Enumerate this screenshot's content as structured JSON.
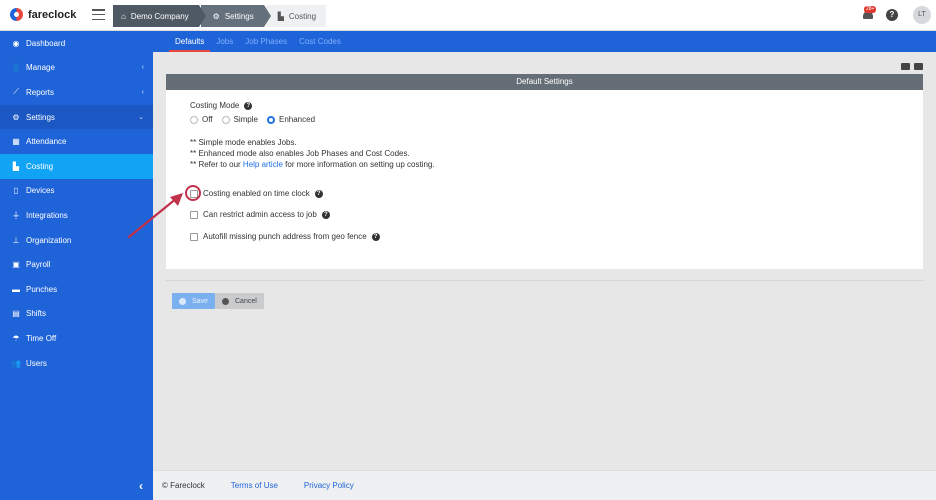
{
  "app": {
    "name": "fareclock"
  },
  "breadcrumbs": [
    {
      "label": "Demo Company",
      "icon": "home-icon"
    },
    {
      "label": "Settings",
      "icon": "gear-icon"
    },
    {
      "label": "Costing",
      "icon": "factory-icon"
    }
  ],
  "header": {
    "notification_count": "28+",
    "help": "?",
    "avatar_initials": "LT"
  },
  "sidebar": {
    "items": [
      {
        "label": "Dashboard",
        "icon": "dashboard-icon"
      },
      {
        "label": "Manage",
        "icon": "user-icon",
        "chevron": "‹"
      },
      {
        "label": "Reports",
        "icon": "chart-icon",
        "chevron": "‹"
      },
      {
        "label": "Settings",
        "icon": "gear-icon",
        "chevron": "⌄"
      },
      {
        "label": "Attendance",
        "icon": "attendance-icon"
      },
      {
        "label": "Costing",
        "icon": "factory-icon"
      },
      {
        "label": "Devices",
        "icon": "tablet-icon"
      },
      {
        "label": "Integrations",
        "icon": "plug-icon"
      },
      {
        "label": "Organization",
        "icon": "sitemap-icon"
      },
      {
        "label": "Payroll",
        "icon": "money-icon"
      },
      {
        "label": "Punches",
        "icon": "truck-icon"
      },
      {
        "label": "Shifts",
        "icon": "calendar-icon"
      },
      {
        "label": "Time Off",
        "icon": "beach-icon"
      },
      {
        "label": "Users",
        "icon": "users-icon"
      }
    ],
    "collapse": "‹"
  },
  "tabs": [
    {
      "label": "Defaults",
      "active": true
    },
    {
      "label": "Jobs"
    },
    {
      "label": "Job Phases"
    },
    {
      "label": "Cost Codes"
    }
  ],
  "card": {
    "title": "Default Settings",
    "costing_mode": {
      "label": "Costing Mode",
      "options": [
        "Off",
        "Simple",
        "Enhanced"
      ],
      "selected": "Enhanced"
    },
    "notes": {
      "line1": "** Simple mode enables Jobs.",
      "line2": "** Enhanced mode also enables Job Phases and Cost Codes.",
      "line3_prefix": "** Refer to our ",
      "line3_link": "Help article",
      "line3_suffix": " for more information on setting up costing."
    },
    "checkboxes": [
      {
        "label": "Costing enabled on time clock",
        "checked": false
      },
      {
        "label": "Can restrict admin access to job",
        "checked": false
      },
      {
        "label": "Autofill missing punch address from geo fence",
        "checked": false
      }
    ]
  },
  "actions": {
    "save": "Save",
    "cancel": "Cancel"
  },
  "footer": {
    "copyright": "© Fareclock",
    "terms": "Terms of Use",
    "privacy": "Privacy Policy"
  },
  "colors": {
    "sidebar": "#1f63d8",
    "active_nav": "#12a4f4",
    "accent_red": "#e8483d",
    "link": "#1f73e8"
  }
}
